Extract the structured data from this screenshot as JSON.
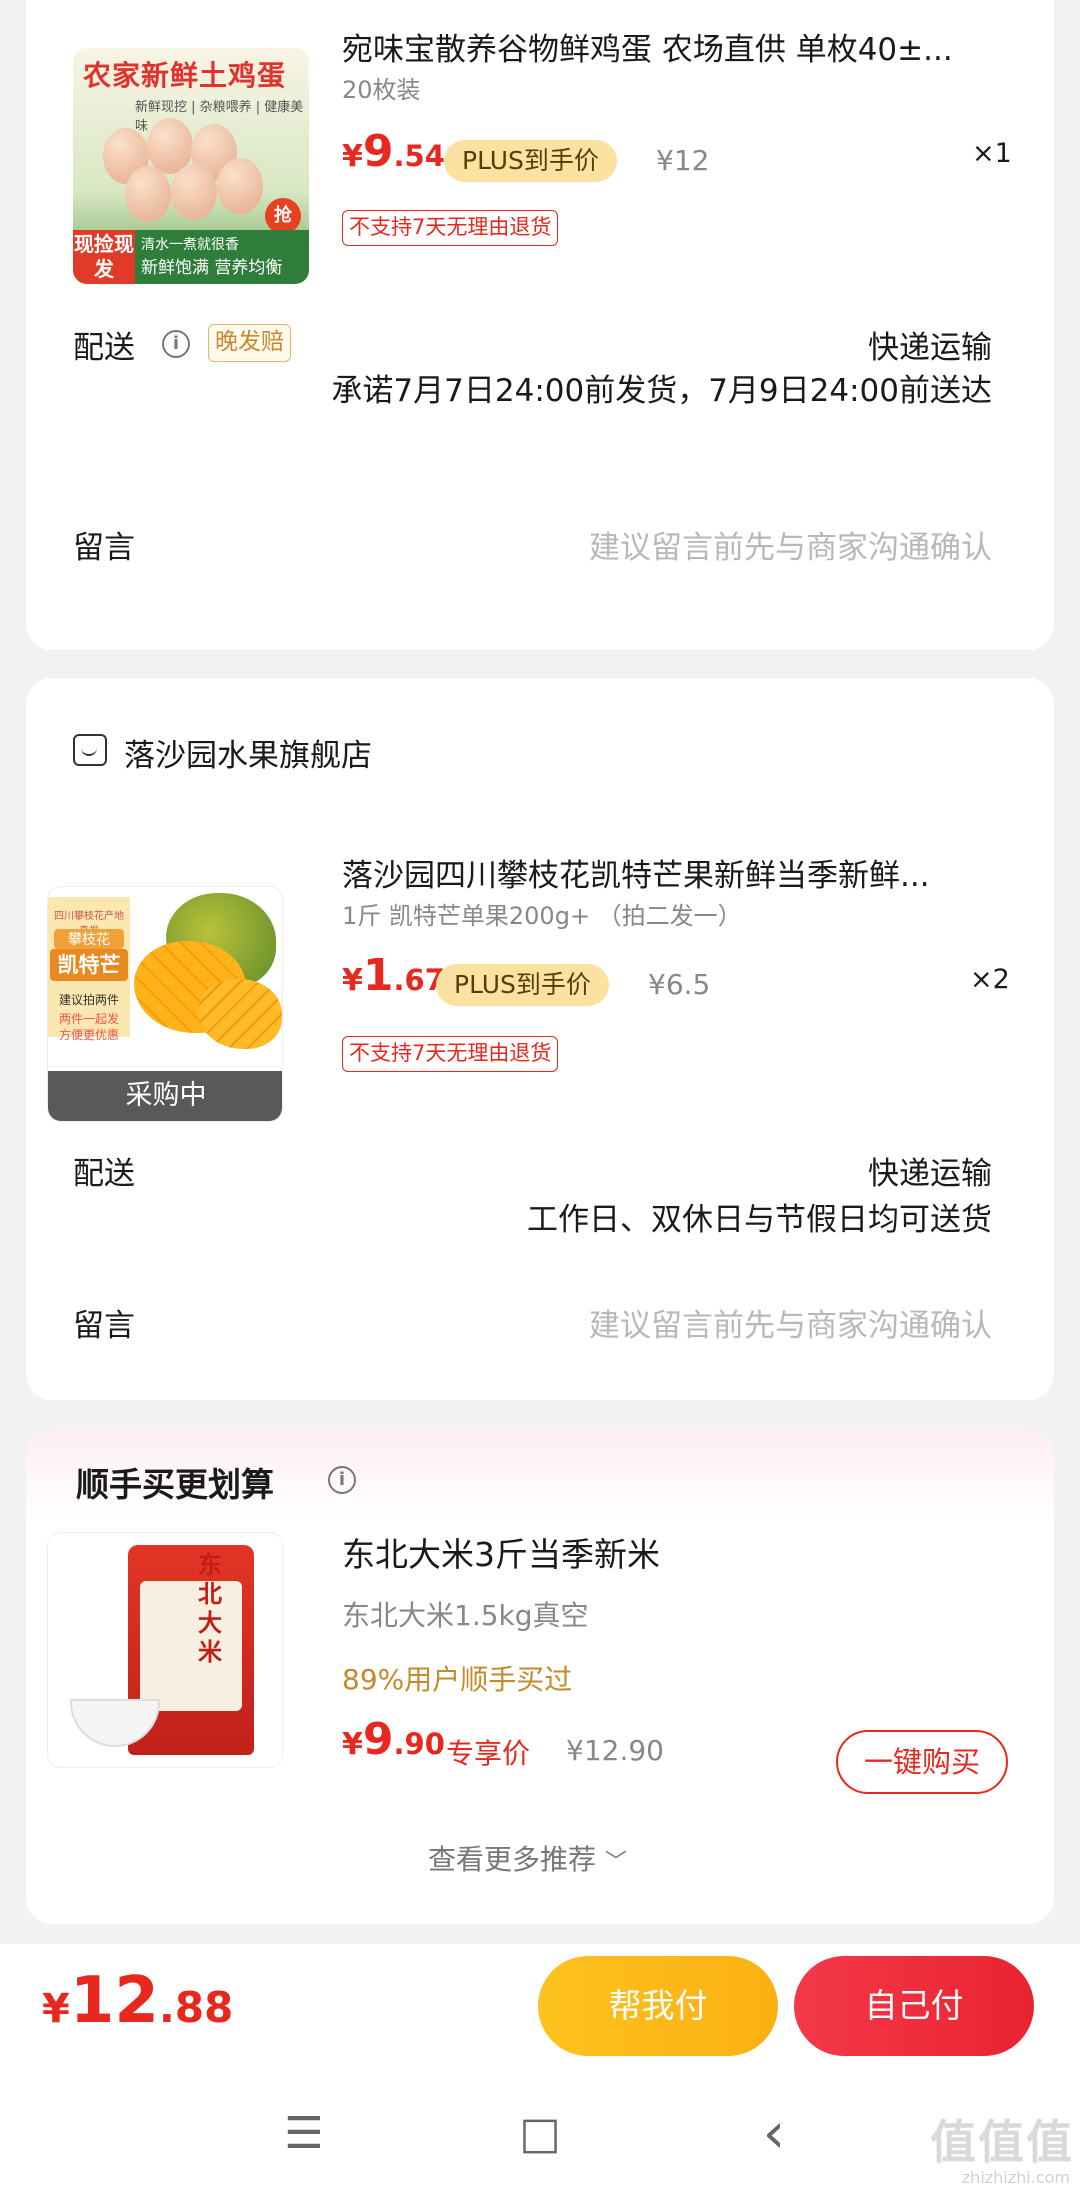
{
  "items": [
    {
      "title": "宛味宝散养谷物鲜鸡蛋 农场直供 单枚40±...",
      "spec": "20枚装",
      "price_yen": "¥",
      "price_int": "9",
      "price_dec": ".54",
      "plus_badge": "PLUS到手价",
      "orig_price": "¥12",
      "qty": "×1",
      "no_return": "不支持7天无理由退货",
      "thumb_text": {
        "banner": "农家新鲜土鸡蛋",
        "sub": "新鲜现挖 | 杂粮喂养 | 健康美味",
        "tag": "现捡现发",
        "bar_line1": "清水一煮就很香",
        "bar_line2": "新鲜饱满 营养均衡",
        "fire": "抢"
      },
      "delivery_label": "配送",
      "late_tag": "晚发赔",
      "delivery_method": "快递运输",
      "delivery_promise": "承诺7月7日24:00前发货，7月9日24:00前送达",
      "message_label": "留言",
      "message_hint": "建议留言前先与商家沟通确认"
    },
    {
      "store_name": "落沙园水果旗舰店",
      "title": "落沙园四川攀枝花凯特芒果新鲜当季新鲜...",
      "spec": "1斤 凯特芒单果200g+ （拍二发一）",
      "price_yen": "¥",
      "price_int": "1",
      "price_dec": ".67",
      "plus_badge": "PLUS到手价",
      "orig_price": "¥6.5",
      "qty": "×2",
      "no_return": "不支持7天无理由退货",
      "thumb_text": {
        "top": "四川攀枝花产地直发",
        "a": "攀枝花",
        "b": "凯特芒",
        "c": "建议拍两件",
        "d": "两件一起发 方便更优惠",
        "ribbon": "采购中"
      },
      "delivery_label": "配送",
      "delivery_method": "快递运输",
      "delivery_promise": "工作日、双休日与节假日均可送货",
      "message_label": "留言",
      "message_hint": "建议留言前先与商家沟通确认"
    }
  ],
  "recommend": {
    "title": "顺手买更划算",
    "product": {
      "title": "东北大米3斤当季新米",
      "spec": "东北大米1.5kg真空",
      "sold": "89%用户顺手买过",
      "price_yen": "¥",
      "price_int": "9",
      "price_dec": ".90",
      "exclusive": "专享价",
      "orig_price": "¥12.90",
      "buy_button": "一键购买",
      "bag_text": "东北大米"
    },
    "more": "查看更多推荐"
  },
  "bottom": {
    "total_yen": "¥",
    "total_int": "12",
    "total_dec": ".88",
    "help_pay": "帮我付",
    "self_pay": "自己付"
  },
  "navbar": {
    "menu": "☰",
    "home": "□",
    "back": "‹"
  },
  "watermark": {
    "logo": "值值值",
    "url": "zhizhizhi.com"
  },
  "colors": {
    "accent_red": "#e8281e",
    "plus_gold": "#fbe2a0",
    "help_pay_yellow": "#fdb91a",
    "self_pay_red": "#ee2b3b"
  }
}
